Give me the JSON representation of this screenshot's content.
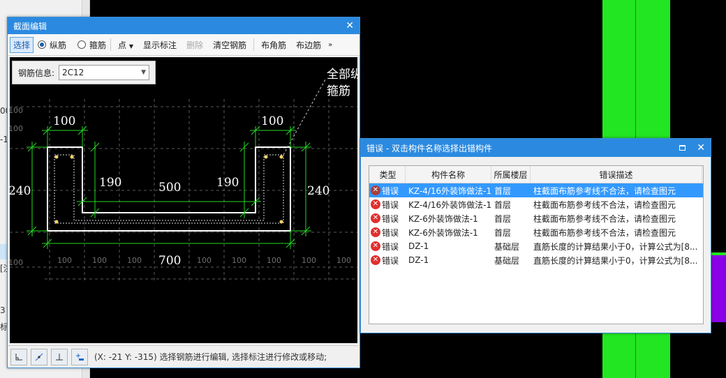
{
  "background": {
    "left_fragments": [
      "00",
      "-1",
      "[注",
      "3",
      "标"
    ]
  },
  "section_editor": {
    "title": "截面编辑",
    "toolbar": {
      "select": "选择",
      "longitudinal": "纵筋",
      "stirrup": "箍筋",
      "point": "点",
      "show_annotation": "显示标注",
      "delete": "删除",
      "clear_rebar": "清空钢筋",
      "corner_rebar": "布角筋",
      "edge_rebar": "布边筋",
      "more": "»"
    },
    "rebar_info_label": "钢筋信息:",
    "rebar_info_value": "2C12",
    "drawing": {
      "dim_top_left": "100",
      "dim_top_right": "100",
      "dim_left": "240",
      "dim_right": "240",
      "dim_inner_left": "190",
      "dim_inner_right": "190",
      "dim_bottom_inner": "500",
      "dim_bottom": "700",
      "grid_label": "100",
      "leader_text_1": "全部纵",
      "leader_text_2": "箍筋"
    },
    "status_text": "(X: -21 Y: -315) 选择钢筋进行编辑, 选择标注进行修改或移动;"
  },
  "error_dialog": {
    "title": "错误 - 双击构件名称选择出错构件",
    "columns": [
      "类型",
      "构件名称",
      "所属楼层",
      "错误描述"
    ],
    "rows": [
      {
        "type": "错误",
        "name": "KZ-4/16外装饰做法-1",
        "floor": "首层",
        "desc": "柱截面布筋参考线不合法，请检查图元",
        "selected": true
      },
      {
        "type": "错误",
        "name": "KZ-4/16外装饰做法-1",
        "floor": "首层",
        "desc": "柱截面布筋参考线不合法，请检查图元",
        "selected": false
      },
      {
        "type": "错误",
        "name": "KZ-6外装饰做法-1",
        "floor": "首层",
        "desc": "柱截面布筋参考线不合法，请检查图元",
        "selected": false
      },
      {
        "type": "错误",
        "name": "KZ-6外装饰做法-1",
        "floor": "首层",
        "desc": "柱截面布筋参考线不合法，请检查图元",
        "selected": false
      },
      {
        "type": "错误",
        "name": "DZ-1",
        "floor": "基础层",
        "desc": "直筋长度的计算结果小于0，计算公式为[8...",
        "selected": false
      },
      {
        "type": "错误",
        "name": "DZ-1",
        "floor": "基础层",
        "desc": "直筋长度的计算结果小于0，计算公式为[8...",
        "selected": false
      }
    ]
  }
}
